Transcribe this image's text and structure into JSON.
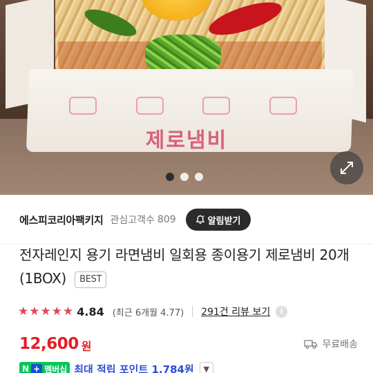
{
  "hero": {
    "brand_text": "제로냄비",
    "carousel": {
      "total": 3,
      "active_index": 0
    },
    "expand_icon": "expand-arrows-icon"
  },
  "seller": {
    "name": "에스피코리아팩키지",
    "fans_label": "관심고객수",
    "fans_count": "809",
    "alarm_label": "알림받기",
    "alarm_icon": "bell-icon"
  },
  "product": {
    "title": "전자레인지 용기 라면냄비 일회용 종이용기 제로냄비 20개 (1BOX)",
    "badge": "BEST"
  },
  "rating": {
    "stars": 5,
    "value": "4.84",
    "recent": "(최근 6개월 4.77)",
    "review_link": "291건 리뷰 보기",
    "info_icon": "info-icon"
  },
  "price": {
    "value": "12,600",
    "unit": "원",
    "shipping_label": "무료배송",
    "shipping_icon": "truck-icon"
  },
  "membership": {
    "badge_n": "N",
    "badge_plus": "+",
    "badge_text": "멤버십",
    "points_text": "최대 적립 포인트 1,784원",
    "accent_color": "#2a4ed8"
  },
  "colors": {
    "price_red": "#e61c26",
    "star_red": "#e2475a",
    "naver_green": "#03c75a"
  }
}
